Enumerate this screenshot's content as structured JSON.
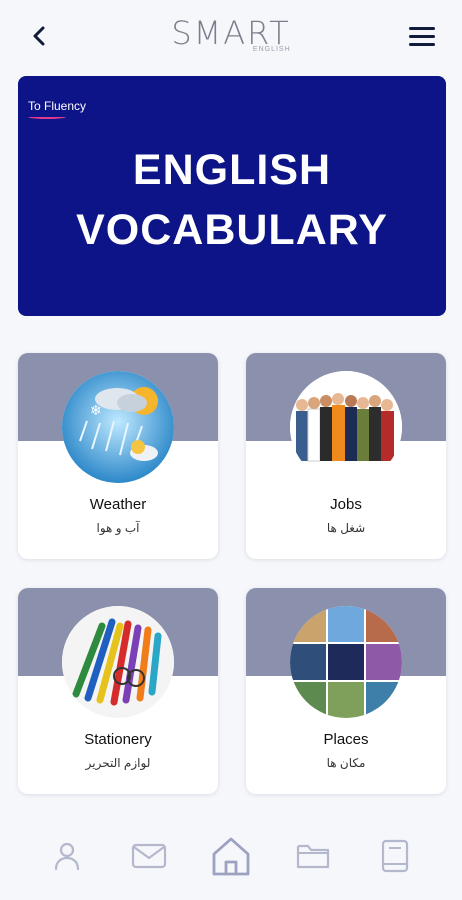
{
  "header": {
    "logo_text": "SMART",
    "logo_sub": "ENGLISH"
  },
  "banner": {
    "tag": "To Fluency",
    "title_line1": "ENGLISH",
    "title_line2": "VOCABULARY",
    "bg_color": "#0d1487"
  },
  "categories": [
    {
      "title": "Weather",
      "subtitle": "آب و هوا",
      "image": "weather-image"
    },
    {
      "title": "Jobs",
      "subtitle": "شغل ها",
      "image": "jobs-image"
    },
    {
      "title": "Stationery",
      "subtitle": "لوازم التحریر",
      "image": "stationery-image"
    },
    {
      "title": "Places",
      "subtitle": "مکان ها",
      "image": "places-image"
    }
  ],
  "nav": [
    {
      "icon": "user-icon"
    },
    {
      "icon": "mail-icon"
    },
    {
      "icon": "home-icon",
      "active": true
    },
    {
      "icon": "folder-icon"
    },
    {
      "icon": "book-icon"
    }
  ]
}
